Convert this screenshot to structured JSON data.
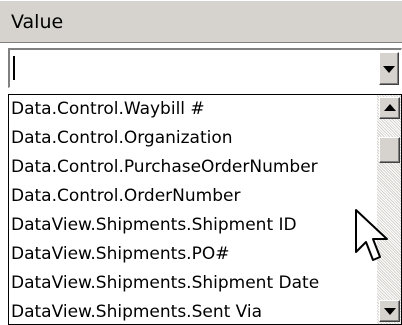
{
  "header": {
    "title": "Value"
  },
  "combo": {
    "value": "",
    "dropdown_icon": "chevron-down-icon"
  },
  "list": {
    "items": [
      "Data.Control.Waybill #",
      "Data.Control.Organization",
      "Data.Control.PurchaseOrderNumber",
      "Data.Control.OrderNumber",
      "DataView.Shipments.Shipment ID",
      "DataView.Shipments.PO#",
      "DataView.Shipments.Shipment Date",
      "DataView.Shipments.Sent Via"
    ]
  },
  "scrollbar": {
    "up_icon": "arrow-up-icon",
    "down_icon": "arrow-down-icon"
  },
  "pointer": {
    "icon": "mouse-pointer-icon"
  },
  "colors": {
    "chrome": "#d6d3ce",
    "border_dark": "#808080",
    "text": "#000000",
    "background": "#ffffff"
  }
}
